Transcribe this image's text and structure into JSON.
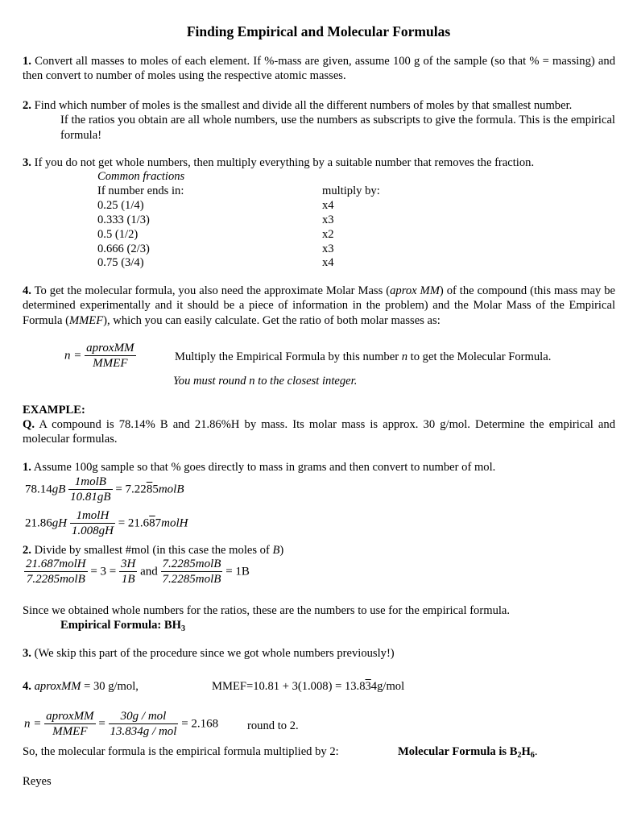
{
  "title": "Finding Empirical and Molecular Formulas",
  "steps": {
    "s1": {
      "num": "1.",
      "text": "Convert all masses to moles of each element. If  %-mass are given, assume 100 g of the sample (so that % = massing) and then convert to number of moles using the respective atomic masses."
    },
    "s2": {
      "num": "2.",
      "line1": "Find which number of moles is the smallest and divide all the different numbers of moles by that smallest number.",
      "line2": "If the ratios you obtain are all whole numbers, use the numbers as subscripts to give the formula. This is the empirical formula!"
    },
    "s3": {
      "num": "3.",
      "text": "If you do not get whole numbers, then multiply everything by a suitable number that removes the fraction."
    },
    "s4": {
      "num": "4.",
      "t1": "To get the molecular formula, you also need the approximate Molar Mass (",
      "t1i": "aprox MM",
      "t2": ") of the compound (this mass may be determined experimentally and it should be a piece of information in the problem) and the Molar Mass of the Empirical Formula (",
      "t2i": "MMEF",
      "t3": "), which you can easily calculate. Get the ratio of both molar masses as:"
    }
  },
  "fractions_table": {
    "caption": "Common fractions",
    "col1_header": "If number ends in:",
    "col2_header": "multiply by:",
    "rows": [
      {
        "ends": "0.25 (1/4)",
        "mult": "x4"
      },
      {
        "ends": "0.333 (1/3)",
        "mult": "x3"
      },
      {
        "ends": "0.5 (1/2)",
        "mult": "x2"
      },
      {
        "ends": "0.666 (2/3)",
        "mult": "x3"
      },
      {
        "ends": "0.75 (3/4)",
        "mult": "x4"
      }
    ]
  },
  "n_formula": {
    "lhs": "n =",
    "num": "aproxMM",
    "den": "MMEF",
    "note_a": "Multiply the Empirical Formula by this number ",
    "note_n": "n",
    "note_b": " to get the Molecular Formula.",
    "round_note": "You must round n to the closest integer."
  },
  "example": {
    "heading": "EXAMPLE:",
    "q_label": "Q.",
    "q_text": "A compound is 78.14% B and 21.86%H by mass. Its molar mass is approx. 30 g/mol. Determine the empirical and molecular formulas.",
    "e1": {
      "num": "1.",
      "text": "Assume 100g sample so that % goes directly to mass in grams and then convert to number of mol."
    },
    "calcB": {
      "lhs_num": "78.14",
      "lhs_unit": "gB",
      "num": "1molB",
      "den": "10.81gB",
      "res_a": "= 7.22",
      "res_bar": "8",
      "res_b": "5",
      "res_unit": "molB"
    },
    "calcH": {
      "lhs_num": "21.86",
      "lhs_unit": "gH",
      "num": "1molH",
      "den": "1.008gH",
      "res_a": "= 21.6",
      "res_bar": "8",
      "res_b": "7",
      "res_unit": "molH"
    },
    "e2": {
      "num": "2.",
      "text_a": "Divide by smallest #mol (in this case the moles of ",
      "text_i": "B",
      "text_b": ")"
    },
    "ratio1": {
      "num": "21.687molH",
      "den": "7.2285molB",
      "mid": "= 3 =",
      "num2": "3H",
      "den2": "1B"
    },
    "and": "and",
    "ratio2": {
      "num": "7.2285molB",
      "den": "7.2285molB",
      "res": "= 1B"
    },
    "since": "Since we obtained whole numbers for the ratios, these are the numbers to use for the empirical formula.",
    "emp_label": "Empirical Formula: BH",
    "emp_sub": "3",
    "e3": {
      "num": "3.",
      "text": "(We skip this part of the procedure since we got whole numbers previously!)"
    },
    "e4": {
      "num": "4.",
      "aprox_label": "aproxMM",
      "aprox_val": " = 30 g/mol,",
      "mmef_a": "MMEF=10.81 + 3(1.008) = 13.8",
      "mmef_bar": "3",
      "mmef_b": "4g/mol"
    },
    "n_calc": {
      "lhs": "n =",
      "num1": "aproxMM",
      "den1": "MMEF",
      "eq": "=",
      "num2": "30g / mol",
      "den2": "13.834g / mol",
      "res": "= 2.168",
      "round": "round to 2."
    },
    "so": "So, the molecular formula is the empirical formula multiplied by 2:",
    "mol_a": "Molecular Formula is B",
    "mol_sub1": "2",
    "mol_b": "H",
    "mol_sub2": "6",
    "mol_end": "."
  },
  "author": "Reyes"
}
